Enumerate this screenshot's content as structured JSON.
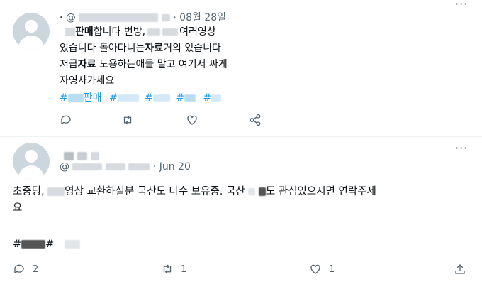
{
  "tweet1": {
    "handle_prefix": "@",
    "date": "08월 28일",
    "lines": [
      {
        "pre": "",
        "bold": "판매",
        "post": "합니다 번방,",
        "tail": "여러영상"
      },
      {
        "pre": "있습니다 돌아다니는",
        "bold": "자료",
        "post": "거의 있습니다"
      },
      {
        "pre": "저급",
        "bold": "자료",
        "post": " 도용하는애들 말고 여기서 싸게"
      },
      {
        "pre": "자영사가세요",
        "bold": "",
        "post": ""
      }
    ],
    "hashtags": {
      "h1": "#",
      "h1b": "판매",
      "h2": "#",
      "h3": "#",
      "h4": "#",
      "h5": "#"
    },
    "actions": [
      {
        "name": "reply-icon",
        "count": ""
      },
      {
        "name": "retweet-icon",
        "count": ""
      },
      {
        "name": "like-icon",
        "count": ""
      },
      {
        "name": "share-icon",
        "count": ""
      }
    ]
  },
  "tweet2": {
    "handle_prefix": "@",
    "date": "Jun 20",
    "line1_a": "초중딩,",
    "line1_b": "영상 교환하실분 국산도 다수 보유중. 국산",
    "line1_c": "도 관심있으시면 연락주세",
    "line2": "요",
    "hashtag_a": "#",
    "hashtag_b": "#",
    "more": "···",
    "actions": [
      {
        "name": "reply-icon",
        "count": "2"
      },
      {
        "name": "retweet-icon",
        "count": "1"
      },
      {
        "name": "like-icon",
        "count": "1"
      },
      {
        "name": "share-icon",
        "count": ""
      }
    ]
  },
  "top_more": "···"
}
